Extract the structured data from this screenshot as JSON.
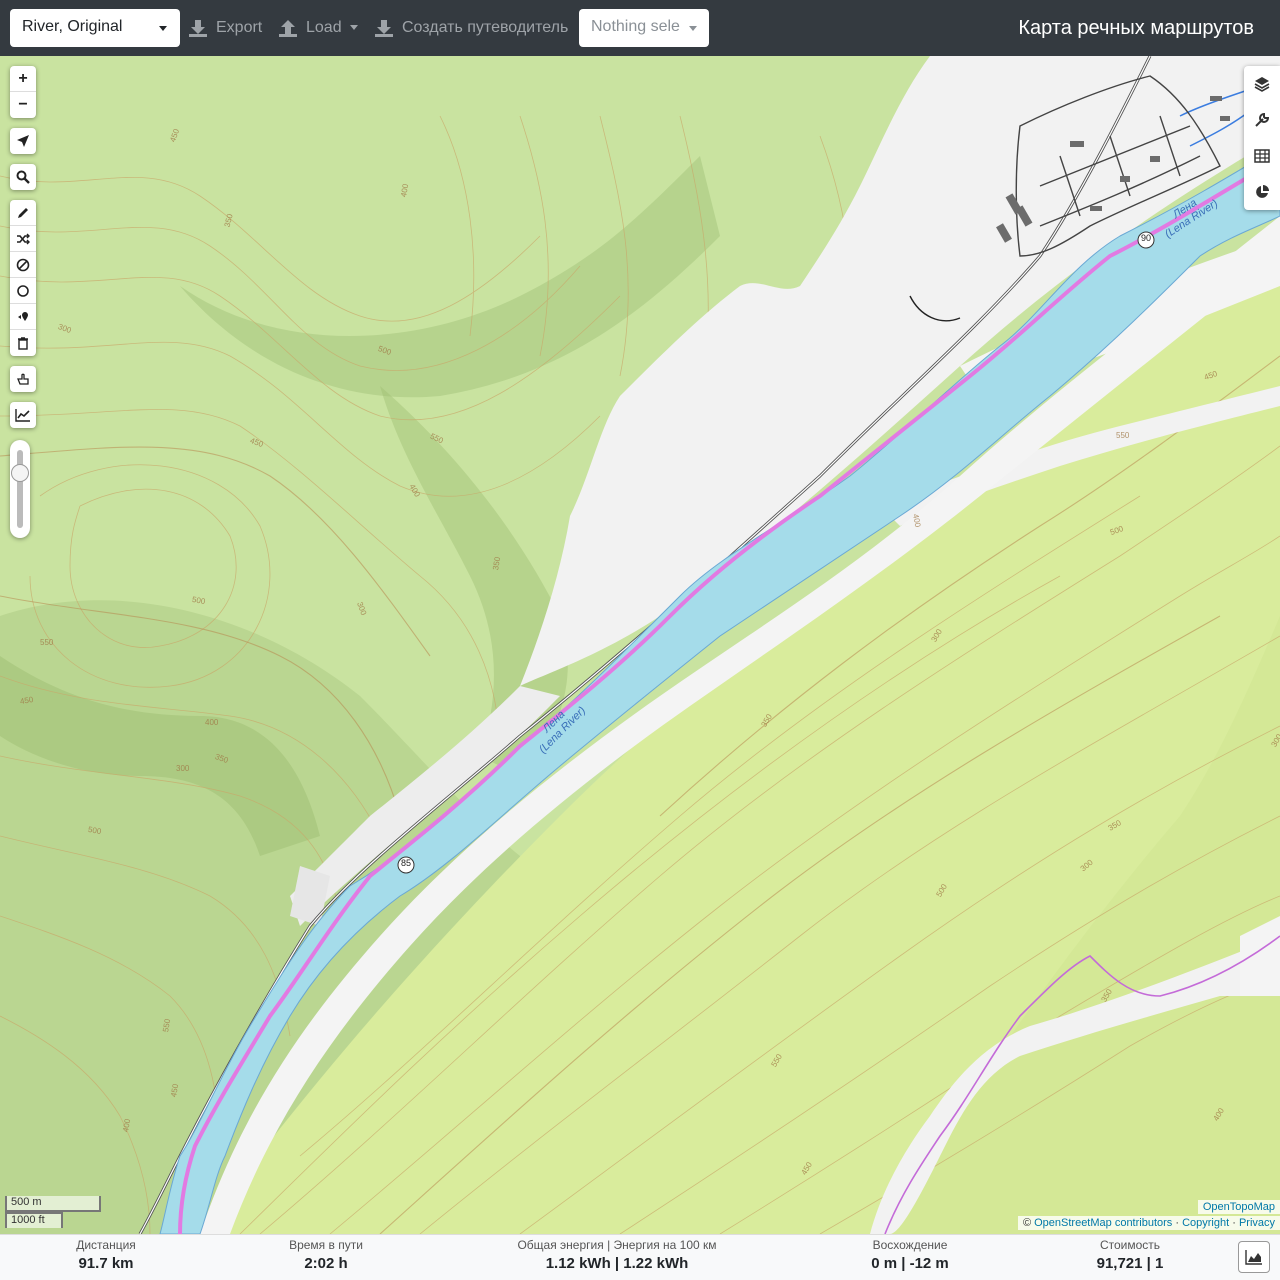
{
  "navbar": {
    "profile": "River, Original",
    "export_label": "Export",
    "load_label": "Load",
    "guide_label": "Создать путеводитель",
    "selection_placeholder": "Nothing sele",
    "title": "Карта речных маршрутов"
  },
  "map": {
    "river_label_1": "Лена",
    "river_label_2": "(Lena River)",
    "road_shield_1": "90",
    "road_shield_2": "85",
    "contour_labels": [
      "450",
      "400",
      "350",
      "300",
      "500",
      "550"
    ],
    "scale_metric": "500 m",
    "scale_imperial": "1000 ft",
    "attribution_top": "OpenTopoMap",
    "attribution_copy": "©",
    "attribution_osm": "OpenStreetMap contributors",
    "attribution_copyright": "Copyright",
    "attribution_privacy": "Privacy",
    "colors": {
      "forest": "#c9e3a0",
      "river": "#a5dcea",
      "route": "#e27ae2",
      "road": "#555555"
    }
  },
  "left_controls": {
    "zoom_in": "+",
    "zoom_out": "−"
  },
  "right_controls": {
    "icons": [
      "layers-icon",
      "wrench-icon",
      "table-icon",
      "pie-chart-icon"
    ]
  },
  "stats": {
    "distance_label": "Дистанция",
    "distance_value": "91.7 km",
    "time_label": "Время в пути",
    "time_value": "2:02 h",
    "energy_label": "Общая энергия | Энергия на 100 км",
    "energy_value": "1.12 kWh | 1.22 kWh",
    "ascent_label": "Восхождение",
    "ascent_value": "0 m | -12 m",
    "cost_label": "Стоимость",
    "cost_value": "91,721 | 1"
  }
}
